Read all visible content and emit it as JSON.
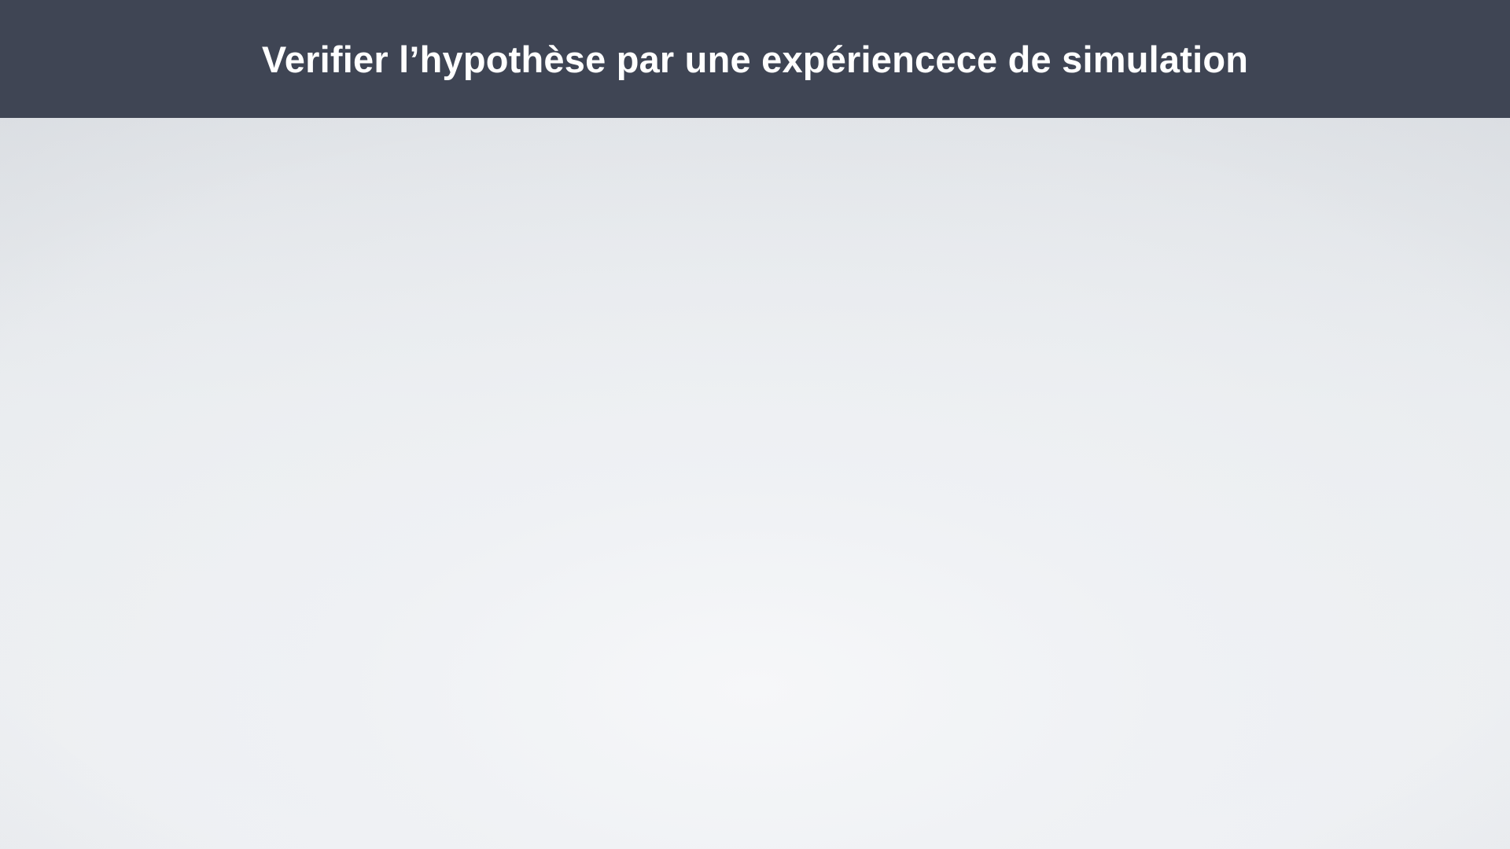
{
  "slide": {
    "title": "Verifier l’hypothèse par une expériencece de simulation"
  },
  "colors": {
    "title_bar": "#3f4554",
    "title_text": "#ffffff",
    "background": "#e2e5e9"
  }
}
